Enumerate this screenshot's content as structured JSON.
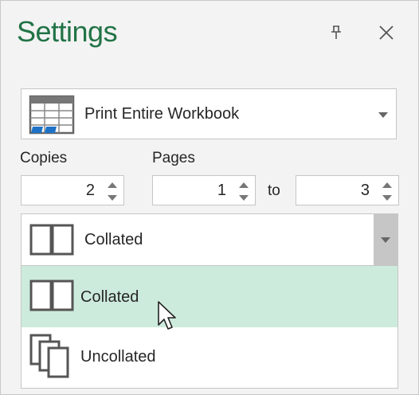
{
  "panel": {
    "title": "Settings",
    "accent_color": "#217346"
  },
  "header": {
    "pin_icon": "pin-icon",
    "close_icon": "close-icon"
  },
  "print_what": {
    "selected": "Print Entire Workbook",
    "icon": "workbook-icon"
  },
  "copies": {
    "label": "Copies",
    "value": "2"
  },
  "pages": {
    "label": "Pages",
    "from": "1",
    "to_label": "to",
    "to": "3"
  },
  "collation": {
    "selected": "Collated",
    "options": [
      {
        "label": "Collated",
        "icon": "collated-icon",
        "highlighted": true
      },
      {
        "label": "Uncollated",
        "icon": "uncollated-icon",
        "highlighted": false
      }
    ],
    "highlight_color": "#cdebdc"
  }
}
